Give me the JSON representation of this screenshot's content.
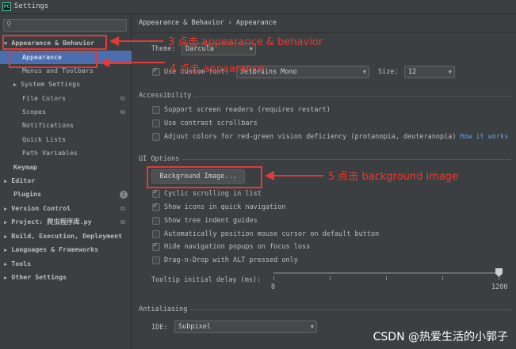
{
  "window": {
    "title": "Settings",
    "app_icon": "PC"
  },
  "search": {
    "placeholder": "",
    "icon": "search-icon"
  },
  "sidebar": {
    "items": [
      {
        "label": "Appearance & Behavior",
        "expanded": true,
        "bold": true
      },
      {
        "label": "Appearance",
        "selected": true
      },
      {
        "label": "Menus and Toolbars"
      },
      {
        "label": "System Settings",
        "collapsed": true
      },
      {
        "label": "File Colors"
      },
      {
        "label": "Scopes"
      },
      {
        "label": "Notifications"
      },
      {
        "label": "Quick Lists"
      },
      {
        "label": "Path Variables"
      },
      {
        "label": "Keymap",
        "bold": true
      },
      {
        "label": "Editor",
        "bold": true,
        "collapsed": true
      },
      {
        "label": "Plugins",
        "bold": true,
        "badge": "2"
      },
      {
        "label": "Version Control",
        "bold": true,
        "collapsed": true
      },
      {
        "label": "Project: 爬虫程序库.py",
        "bold": true,
        "collapsed": true
      },
      {
        "label": "Build, Execution, Deployment",
        "bold": true,
        "collapsed": true
      },
      {
        "label": "Languages & Frameworks",
        "bold": true,
        "collapsed": true
      },
      {
        "label": "Tools",
        "bold": true,
        "collapsed": true
      },
      {
        "label": "Other Settings",
        "bold": true,
        "collapsed": true
      }
    ]
  },
  "breadcrumb": {
    "part1": "Appearance & Behavior",
    "sep": "›",
    "part2": "Appearance"
  },
  "theme": {
    "label": "Theme:",
    "value": "Darcula"
  },
  "font": {
    "checkbox_label": "Use custom font:",
    "checked": true,
    "value": "JetBrains Mono",
    "size_label": "Size:",
    "size_value": "12"
  },
  "accessibility": {
    "title": "Accessibility",
    "options": [
      {
        "label": "Support screen readers (requires restart)",
        "checked": false
      },
      {
        "label": "Use contrast scrollbars",
        "checked": false
      },
      {
        "label": "Adjust colors for red-green vision deficiency (protanopia, deuteranopia)",
        "checked": false
      }
    ],
    "link": "How it works"
  },
  "ui_options": {
    "title": "UI Options",
    "button": "Background Image...",
    "options": [
      {
        "label": "Cyclic scrolling in list",
        "checked": true
      },
      {
        "label": "Show icons in quick navigation",
        "checked": true
      },
      {
        "label": "Show tree indent guides",
        "checked": false
      },
      {
        "label": "Automatically position mouse cursor on default button",
        "checked": false
      },
      {
        "label": "Hide navigation popups on focus loss",
        "checked": true
      },
      {
        "label": "Drag-n-Drop with ALT pressed only",
        "checked": false
      }
    ],
    "tooltip_label": "Tooltip initial delay (ms):",
    "slider_min": "0",
    "slider_max": "1200",
    "slider_value": 1200
  },
  "antialiasing": {
    "title": "Antialiasing",
    "ide_label": "IDE:",
    "ide_value": "Subpixel"
  },
  "annotations": {
    "step3": "3 点击 appearance & behavior",
    "step4": "4 点击 appearance",
    "step5": "5 点击 background image",
    "color": "#e23a3a"
  },
  "watermark": "CSDN @热爱生活的小郭子",
  "colors": {
    "background": "#3c3f41",
    "selection": "#4b6eaf",
    "link": "#589df6"
  }
}
